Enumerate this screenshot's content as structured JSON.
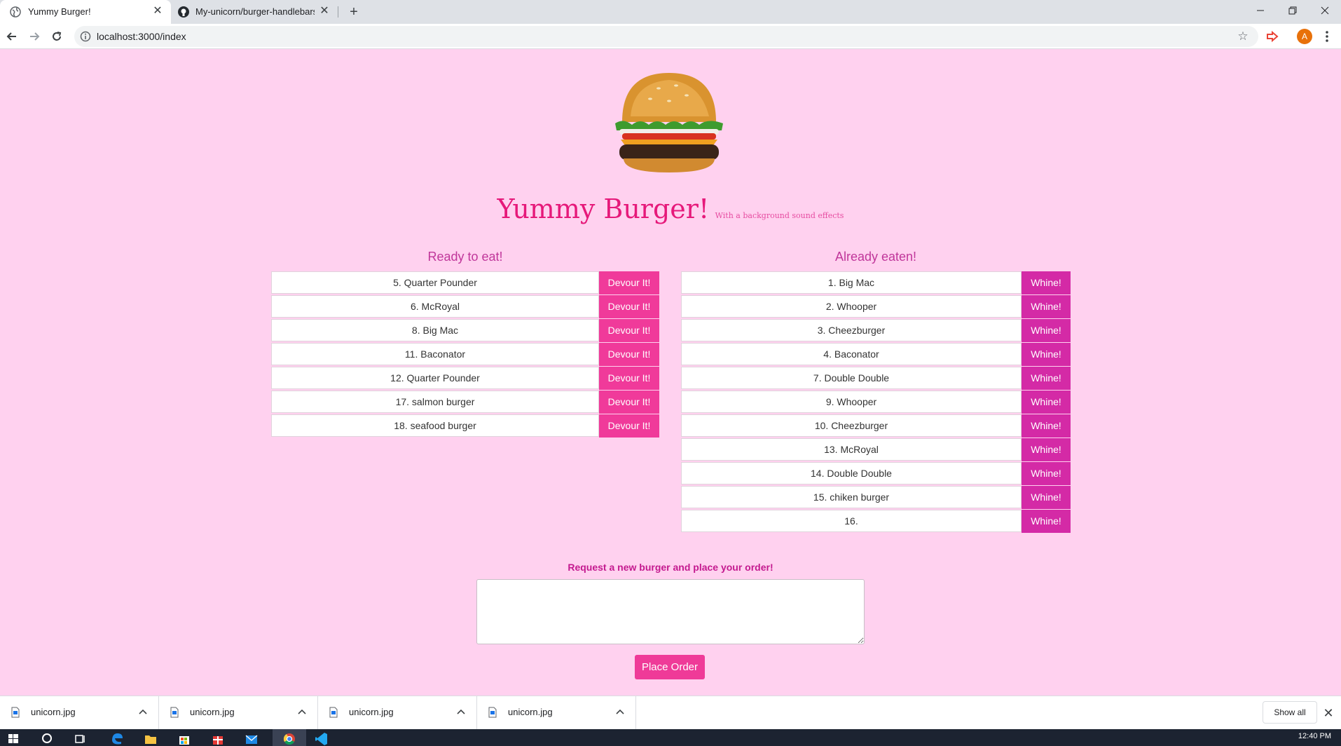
{
  "browser": {
    "tabs": [
      {
        "title": "Yummy Burger!",
        "active": true,
        "icon": "globe-icon"
      },
      {
        "title": "My-unicorn/burger-handlebars",
        "active": false,
        "icon": "github-icon"
      }
    ],
    "url": "localhost:3000/index",
    "profile_initial": "A"
  },
  "page": {
    "title": "Yummy Burger!",
    "subtitle": "With a background sound effects",
    "ready_heading": "Ready to eat!",
    "eaten_heading": "Already eaten!",
    "ready_burgers": [
      {
        "label": "5. Quarter Pounder",
        "action": "Devour It!"
      },
      {
        "label": "6. McRoyal",
        "action": "Devour It!"
      },
      {
        "label": "8. Big Mac",
        "action": "Devour It!"
      },
      {
        "label": "11. Baconator",
        "action": "Devour It!"
      },
      {
        "label": "12. Quarter Pounder",
        "action": "Devour It!"
      },
      {
        "label": "17. salmon burger",
        "action": "Devour It!"
      },
      {
        "label": "18. seafood burger",
        "action": "Devour It!"
      }
    ],
    "eaten_burgers": [
      {
        "label": "1. Big Mac",
        "action": "Whine!"
      },
      {
        "label": "2. Whooper",
        "action": "Whine!"
      },
      {
        "label": "3. Cheezburger",
        "action": "Whine!"
      },
      {
        "label": "4. Baconator",
        "action": "Whine!"
      },
      {
        "label": "7. Double Double",
        "action": "Whine!"
      },
      {
        "label": "9. Whooper",
        "action": "Whine!"
      },
      {
        "label": "10. Cheezburger",
        "action": "Whine!"
      },
      {
        "label": "13. McRoyal",
        "action": "Whine!"
      },
      {
        "label": "14. Double Double",
        "action": "Whine!"
      },
      {
        "label": "15. chiken burger",
        "action": "Whine!"
      },
      {
        "label": "16.",
        "action": "Whine!"
      }
    ],
    "request_label": "Request a new burger and place your order!",
    "order_value": "",
    "place_order_label": "Place Order"
  },
  "downloads": {
    "items": [
      "unicorn.jpg",
      "unicorn.jpg",
      "unicorn.jpg",
      "unicorn.jpg"
    ],
    "show_all_label": "Show all"
  },
  "taskbar": {
    "time": "12:40 PM"
  },
  "colors": {
    "page_bg": "#ffd1ef",
    "title_pink": "#e6197a",
    "devour_button": "#f03a9a",
    "whine_button": "#d42aa6",
    "heading_purple": "#c0369a"
  }
}
